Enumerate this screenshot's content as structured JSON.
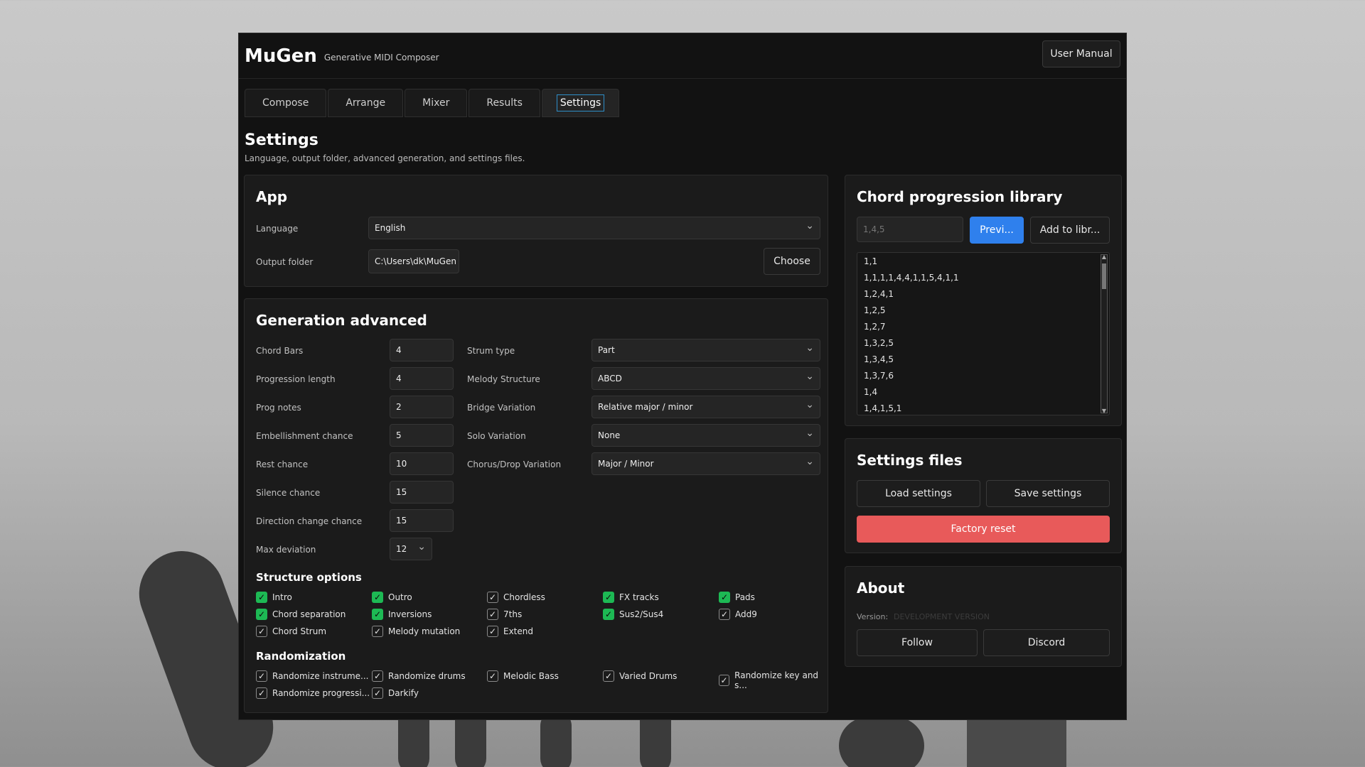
{
  "app": {
    "title": "MuGen",
    "subtitle": "Generative MIDI Composer",
    "manual_label": "User Manual"
  },
  "tabs": [
    {
      "label": "Compose"
    },
    {
      "label": "Arrange"
    },
    {
      "label": "Mixer"
    },
    {
      "label": "Results"
    },
    {
      "label": "Settings"
    }
  ],
  "page": {
    "title": "Settings",
    "description": "Language, output folder, advanced generation, and settings files."
  },
  "app_panel": {
    "title": "App",
    "language_label": "Language",
    "language_value": "English",
    "output_label": "Output folder",
    "output_value": "C:\\Users\\dk\\MuGen",
    "choose_label": "Choose"
  },
  "generation": {
    "title": "Generation advanced",
    "left_fields": [
      {
        "label": "Chord Bars",
        "value": "4"
      },
      {
        "label": "Progression length",
        "value": "4"
      },
      {
        "label": "Prog notes",
        "value": "2"
      },
      {
        "label": "Embellishment chance",
        "value": "5"
      },
      {
        "label": "Rest chance",
        "value": "10"
      },
      {
        "label": "Silence chance",
        "value": "15"
      },
      {
        "label": "Direction change chance",
        "value": "15"
      },
      {
        "label": "Max deviation",
        "value": "12"
      }
    ],
    "right_fields": [
      {
        "label": "Strum type",
        "value": "Part"
      },
      {
        "label": "Melody Structure",
        "value": "ABCD"
      },
      {
        "label": "Bridge Variation",
        "value": "Relative major / minor"
      },
      {
        "label": "Solo Variation",
        "value": "None"
      },
      {
        "label": "Chorus/Drop Variation",
        "value": "Major / Minor"
      }
    ],
    "structure_title": "Structure options",
    "structure": [
      {
        "label": "Intro",
        "green": true
      },
      {
        "label": "Outro",
        "green": true
      },
      {
        "label": "Chordless",
        "green": false
      },
      {
        "label": "FX tracks",
        "green": true
      },
      {
        "label": "Pads",
        "green": true
      },
      {
        "label": "Chord separation",
        "green": true
      },
      {
        "label": "Inversions",
        "green": true
      },
      {
        "label": "7ths",
        "green": false
      },
      {
        "label": "Sus2/Sus4",
        "green": true
      },
      {
        "label": "Add9",
        "green": false
      },
      {
        "label": "Chord Strum",
        "green": false
      },
      {
        "label": "Melody mutation",
        "green": false
      },
      {
        "label": "Extend",
        "green": false
      }
    ],
    "random_title": "Randomization",
    "random": [
      {
        "label": "Randomize instrume..."
      },
      {
        "label": "Randomize drums"
      },
      {
        "label": "Melodic Bass"
      },
      {
        "label": "Varied Drums"
      },
      {
        "label": "Randomize key and s..."
      },
      {
        "label": "Randomize progressi..."
      },
      {
        "label": "Darkify"
      }
    ]
  },
  "library": {
    "title": "Chord progression library",
    "input_placeholder": "1,4,5",
    "preview_label": "Previ...",
    "add_label": "Add to libr...",
    "items": [
      "1,1",
      "1,1,1,1,4,4,1,1,5,4,1,1",
      "1,2,4,1",
      "1,2,5",
      "1,2,7",
      "1,3,2,5",
      "1,3,4,5",
      "1,3,7,6",
      "1,4",
      "1,4,1,5,1"
    ]
  },
  "settings_files": {
    "title": "Settings files",
    "load_label": "Load settings",
    "save_label": "Save settings",
    "reset_label": "Factory reset"
  },
  "about": {
    "title": "About",
    "version_label": "Version:",
    "version_value": "DEVELOPMENT VERSION",
    "follow_label": "Follow",
    "discord_label": "Discord"
  },
  "colors": {
    "accent": "#2f80ed",
    "danger": "#e85a5a",
    "check_green": "#1db954",
    "window_bg": "#121212"
  }
}
